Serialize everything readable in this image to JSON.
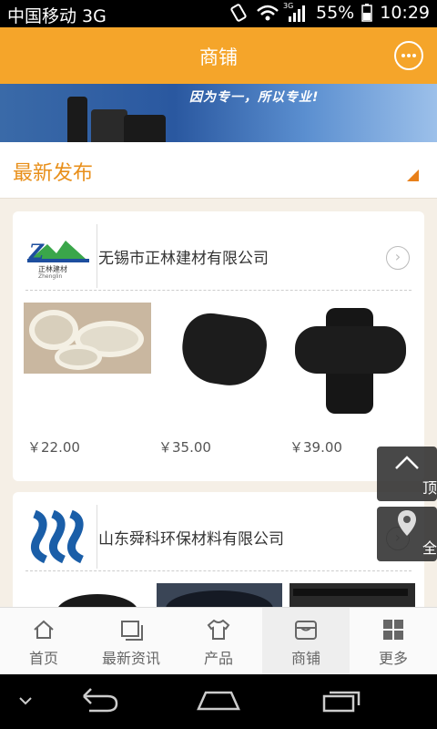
{
  "status": {
    "carrier": "中国移动 3G",
    "net_label": "3G",
    "battery": "55%",
    "time": "10:29"
  },
  "header": {
    "title": "商铺",
    "message_icon": "message-icon"
  },
  "banner": {
    "slogan": "因为专一，所以专业!"
  },
  "section": {
    "title": "最新发布"
  },
  "shops": [
    {
      "name": "无锡市正林建材有限公司",
      "logo_text": "正林建材",
      "logo_sub": "Zhenglin",
      "products": [
        {
          "price": "￥22.00"
        },
        {
          "price": "￥35.00"
        },
        {
          "price": "￥39.00"
        }
      ]
    },
    {
      "name": "山东舜科环保材料有限公司"
    }
  ],
  "float": {
    "top_label": "顶部",
    "all_label": "全国"
  },
  "tabs": [
    {
      "label": "首页",
      "icon": "home-icon"
    },
    {
      "label": "最新资讯",
      "icon": "news-icon"
    },
    {
      "label": "产品",
      "icon": "shirt-icon"
    },
    {
      "label": "商铺",
      "icon": "shop-icon",
      "active": true
    },
    {
      "label": "更多",
      "icon": "grid-icon"
    }
  ]
}
